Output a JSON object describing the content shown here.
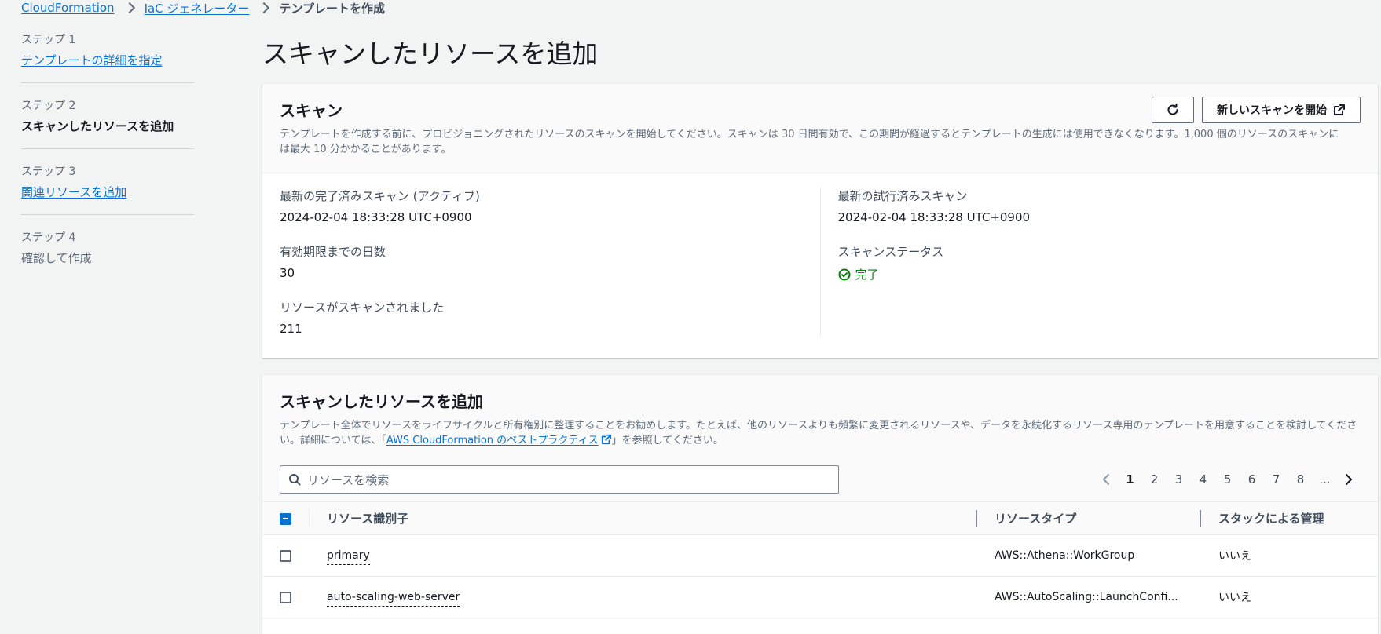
{
  "breadcrumb": {
    "items": [
      {
        "label": "CloudFormation"
      },
      {
        "label": "IaC ジェネレーター"
      }
    ],
    "current": "テンプレートを作成"
  },
  "steps": [
    {
      "step_label": "ステップ 1",
      "name": "テンプレートの詳細を指定",
      "state": "link"
    },
    {
      "step_label": "ステップ 2",
      "name": "スキャンしたリソースを追加",
      "state": "active"
    },
    {
      "step_label": "ステップ 3",
      "name": "関連リソースを追加",
      "state": "link"
    },
    {
      "step_label": "ステップ 4",
      "name": "確認して作成",
      "state": "disabled"
    }
  ],
  "page": {
    "title": "スキャンしたリソースを追加"
  },
  "scan": {
    "title": "スキャン",
    "description": "テンプレートを作成する前に、プロビジョニングされたリソースのスキャンを開始してください。スキャンは 30 日間有効で、この期間が経過するとテンプレートの生成には使用できなくなります。1,000 個のリソースのスキャンには最大 10 分かかることがあります。",
    "refresh_icon": "refresh-icon",
    "new_scan_label": "新しいスキャンを開始",
    "latest_completed_label": "最新の完了済みスキャン (アクティブ)",
    "latest_completed_value": "2024-02-04 18:33:28 UTC+0900",
    "days_until_expiry_label": "有効期限までの日数",
    "days_until_expiry_value": "30",
    "resources_scanned_label": "リソースがスキャンされました",
    "resources_scanned_value": "211",
    "latest_attempted_label": "最新の試行済みスキャン",
    "latest_attempted_value": "2024-02-04 18:33:28 UTC+0900",
    "status_label": "スキャンステータス",
    "status_value": "完了",
    "status_color": "#037f0c"
  },
  "resources": {
    "title": "スキャンしたリソースを追加",
    "description_before": "テンプレート全体でリソースをライフサイクルと所有権別に整理することをお勧めします。たとえば、他のリソースよりも頻繁に変更されるリソースや、データを永続化するリソース専用のテンプレートを用意することを検討してください。詳細については、「",
    "description_link": "AWS CloudFormation のベストプラクティス",
    "description_after": "」を参照してください。",
    "search_placeholder": "リソースを検索",
    "pagination": {
      "pages": [
        "1",
        "2",
        "3",
        "4",
        "5",
        "6",
        "7",
        "8",
        "..."
      ],
      "current": "1"
    },
    "columns": {
      "id": "リソース識別子",
      "type": "リソースタイプ",
      "managed": "スタックによる管理"
    },
    "rows": [
      {
        "id": "primary",
        "type": "AWS::Athena::WorkGroup",
        "managed": "いいえ"
      },
      {
        "id": "auto-scaling-web-server",
        "type": "AWS::AutoScaling::LaunchConfi...",
        "managed": "いいえ"
      }
    ]
  },
  "colors": {
    "accent": "#0972d3",
    "background": "#f2f3f3"
  }
}
